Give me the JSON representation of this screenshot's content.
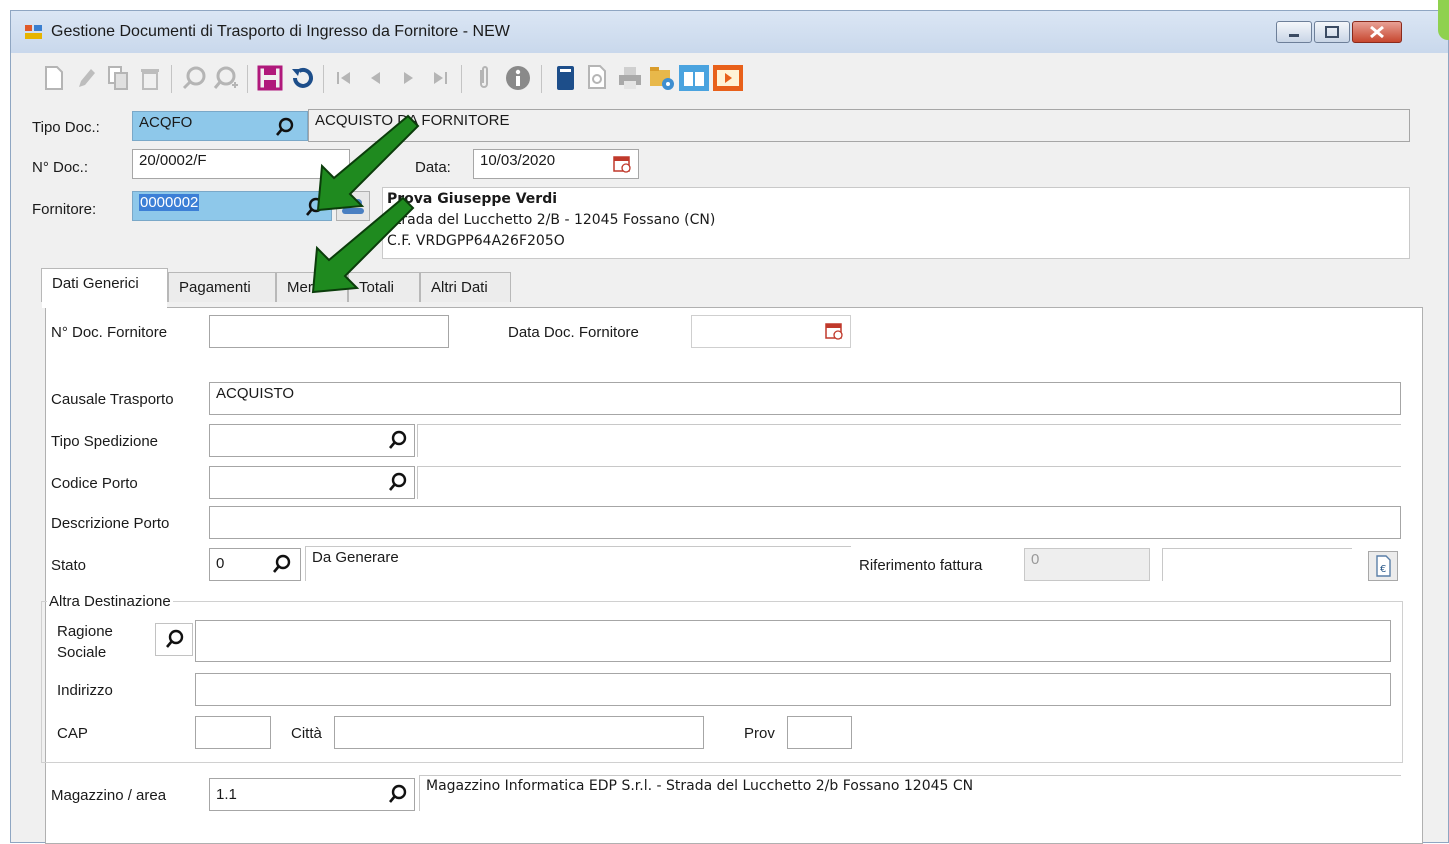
{
  "window": {
    "title": "Gestione Documenti di Trasporto di Ingresso da Fornitore - NEW"
  },
  "toolbar": {
    "icons": [
      "new-doc-icon",
      "edit-pencil-icon",
      "copy-icon",
      "delete-icon",
      "search-icon",
      "search-plus-icon",
      "save-icon",
      "refresh-icon",
      "first-record-icon",
      "prev-record-icon",
      "next-record-icon",
      "last-record-icon",
      "attachment-icon",
      "info-icon",
      "book-icon",
      "preview-icon",
      "print-icon",
      "settings-folder-icon",
      "manual-icon",
      "video-icon"
    ]
  },
  "header": {
    "tipo_doc_label": "Tipo Doc.:",
    "tipo_doc_value": "ACQFO",
    "tipo_doc_desc": "ACQUISTO DA FORNITORE",
    "n_doc_label": "N° Doc.:",
    "n_doc_value": "20/0002/F",
    "data_label": "Data:",
    "data_value": "10/03/2020",
    "fornitore_label": "Fornitore:",
    "fornitore_value": "0000002",
    "fornitore_name": "Prova Giuseppe Verdi",
    "fornitore_address": "Strada del Lucchetto 2/B - 12045 Fossano (CN)",
    "fornitore_cf": "C.F. VRDGPP64A26F205O"
  },
  "tabs": [
    "Dati Generici",
    "Pagamenti",
    "Merci",
    "Totali",
    "Altri Dati"
  ],
  "main": {
    "n_doc_fornitore_label": "N° Doc. Fornitore",
    "n_doc_fornitore_value": "",
    "data_doc_fornitore_label": "Data Doc. Fornitore",
    "data_doc_fornitore_value": "",
    "causale_label": "Causale Trasporto",
    "causale_value": "ACQUISTO",
    "tipo_spedizione_label": "Tipo Spedizione",
    "codice_porto_label": "Codice Porto",
    "descrizione_porto_label": "Descrizione Porto",
    "stato_label": "Stato",
    "stato_value": "0",
    "stato_desc": "Da Generare",
    "rif_fattura_label": "Riferimento fattura",
    "rif_fattura_value": "0",
    "altra_dest_label": "Altra Destinazione",
    "ragione_label_1": "Ragione",
    "ragione_label_2": "Sociale",
    "indirizzo_label": "Indirizzo",
    "cap_label": "CAP",
    "citta_label": "Città",
    "prov_label": "Prov",
    "magazzino_label": "Magazzino / area",
    "magazzino_value": "1.1",
    "magazzino_desc": "Magazzino Informatica EDP S.r.l. - Strada del Lucchetto 2/b Fossano 12045 CN"
  },
  "colors": {
    "highlight_field": "#8ec8ea",
    "arrow_green": "#1f8a1f"
  }
}
